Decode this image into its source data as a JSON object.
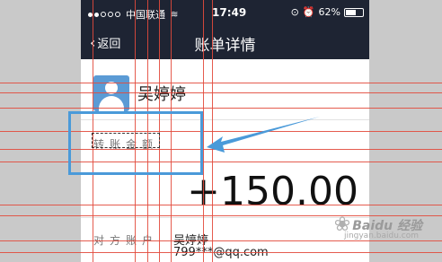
{
  "status_bar": {
    "carrier": "中国联通",
    "time": "17:49",
    "battery": "62%",
    "battery_level": 0.62
  },
  "nav": {
    "back_label": "返回",
    "title": "账单详情"
  },
  "user": {
    "name": "吴婷婷"
  },
  "detail": {
    "amount_label": "转账金额",
    "amount": "+150.00",
    "counterparty_label": "对方账户",
    "counterparty_name": "吴婷婷",
    "counterparty_email": "799***@qq.com"
  },
  "watermark": {
    "brand": "Baidu 经验",
    "site": "jingyan.baidu.com"
  },
  "colors": {
    "header_bg": "#1e2433",
    "annotation_blue": "#4a9ad9",
    "annotation_red": "#e24a3c",
    "avatar": "#5b9bd5"
  }
}
